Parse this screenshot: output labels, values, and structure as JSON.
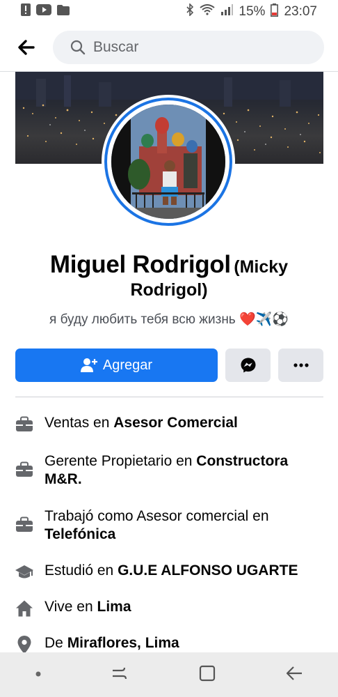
{
  "status_bar": {
    "battery": "15%",
    "time": "23:07"
  },
  "header": {
    "search_placeholder": "Buscar"
  },
  "profile": {
    "name": "Miguel Rodrigol",
    "alt_name_part1": "(Micky",
    "alt_name_part2": "Rodrigol)",
    "bio": "я буду любить тебя всю жизнь ❤️✈️⚽"
  },
  "actions": {
    "add_label": "Agregar"
  },
  "details": [
    {
      "icon": "briefcase-icon",
      "prefix": "Ventas en ",
      "bold": "Asesor Comercial"
    },
    {
      "icon": "briefcase-icon",
      "prefix": "Gerente Propietario en ",
      "bold": "Constructora M&R."
    },
    {
      "icon": "briefcase-icon",
      "prefix": "Trabajó como Asesor comercial en ",
      "bold": "Telefónica"
    },
    {
      "icon": "graduation-cap-icon",
      "prefix": "Estudió en ",
      "bold": "G.U.E ALFONSO UGARTE"
    },
    {
      "icon": "home-icon",
      "prefix": "Vive en ",
      "bold": "Lima"
    },
    {
      "icon": "location-pin-icon",
      "prefix": "De ",
      "bold": "Miraflores, Lima"
    }
  ],
  "colors": {
    "accent": "#1877f2",
    "avatar_ring": "#1b74e4",
    "secondary_button": "#e4e6eb"
  }
}
